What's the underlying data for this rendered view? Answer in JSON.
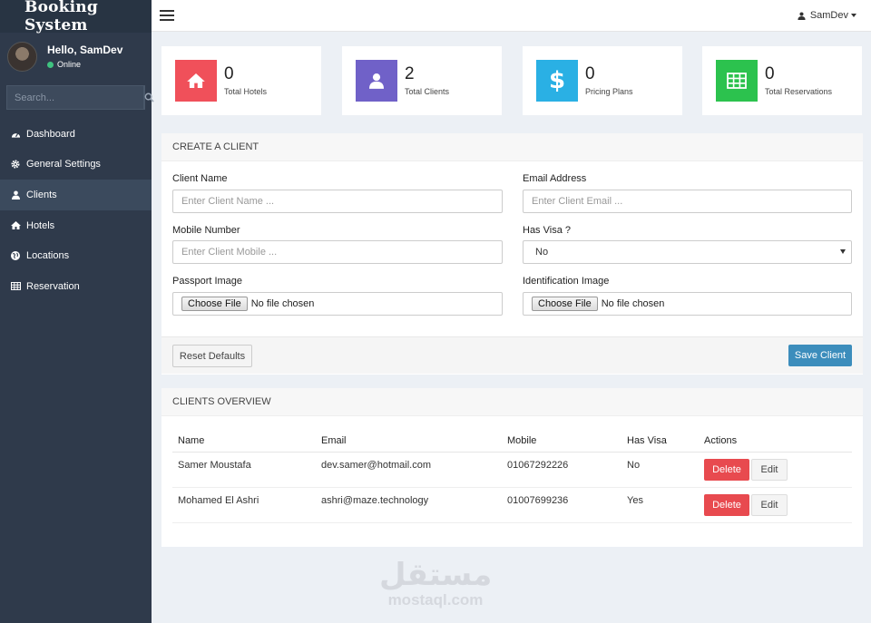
{
  "sidebar": {
    "brand": "Booking System",
    "user": {
      "greeting": "Hello, SamDev",
      "status": "Online"
    },
    "search": {
      "placeholder": "Search..."
    },
    "items": [
      {
        "label": "Dashboard",
        "icon": "dashboard-icon"
      },
      {
        "label": "General Settings",
        "icon": "gear-icon"
      },
      {
        "label": "Clients",
        "icon": "user-icon"
      },
      {
        "label": "Hotels",
        "icon": "home-icon"
      },
      {
        "label": "Locations",
        "icon": "globe-icon"
      },
      {
        "label": "Reservation",
        "icon": "table-icon"
      }
    ],
    "active_item": "Clients"
  },
  "topbar": {
    "user": "SamDev"
  },
  "stats": [
    {
      "value": "0",
      "label": "Total Hotels",
      "color": "#f0505a",
      "icon": "home-icon"
    },
    {
      "value": "2",
      "label": "Total Clients",
      "color": "#7061c8",
      "icon": "user-icon"
    },
    {
      "value": "0",
      "label": "Pricing Plans",
      "color": "#2ab0e4",
      "icon": "dollar-icon"
    },
    {
      "value": "0",
      "label": "Total Reservations",
      "color": "#2cc24e",
      "icon": "table-icon"
    }
  ],
  "create_form": {
    "title": "CREATE A CLIENT",
    "client_name": {
      "label": "Client Name",
      "placeholder": "Enter Client Name ..."
    },
    "email": {
      "label": "Email Address",
      "placeholder": "Enter Client Email ..."
    },
    "mobile": {
      "label": "Mobile Number",
      "placeholder": "Enter Client Mobile ..."
    },
    "has_visa": {
      "label": "Has Visa ?",
      "value": "No"
    },
    "passport": {
      "label": "Passport Image",
      "button": "Choose File",
      "status": "No file chosen"
    },
    "identification": {
      "label": "Identification Image",
      "button": "Choose File",
      "status": "No file chosen"
    },
    "reset_label": "Reset Defaults",
    "save_label": "Save Client"
  },
  "overview": {
    "title": "CLIENTS OVERVIEW",
    "columns": [
      "Name",
      "Email",
      "Mobile",
      "Has Visa",
      "Actions"
    ],
    "rows": [
      {
        "name": "Samer Moustafa",
        "email": "dev.samer@hotmail.com",
        "mobile": "01067292226",
        "has_visa": "No"
      },
      {
        "name": "Mohamed El Ashri",
        "email": "ashri@maze.technology",
        "mobile": "01007699236",
        "has_visa": "Yes"
      }
    ],
    "delete_label": "Delete",
    "edit_label": "Edit"
  },
  "watermark": {
    "arabic": "مستقل",
    "latin": "mostaql.com"
  }
}
